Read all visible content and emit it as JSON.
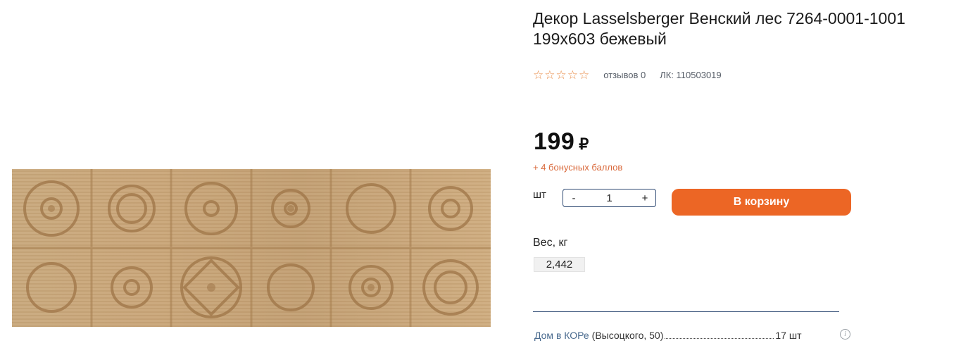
{
  "product": {
    "title": "Декор Lasselsberger Венский лес 7264-0001-1001 199х603 бежевый",
    "rating": {
      "stars": 0,
      "max": 5,
      "star_icon": "star-outline-icon"
    },
    "reviews_label": "отзывов 0",
    "sku_label": "ЛК: 110503019",
    "price": "199",
    "currency": "₽",
    "bonus": "+ 4 бонусных баллов"
  },
  "purchase": {
    "unit": "шт",
    "qty_minus": "-",
    "qty_value": "1",
    "qty_plus": "+",
    "cart_button": "В корзину"
  },
  "specs": {
    "weight_label": "Вес, кг",
    "weight_value": "2,442"
  },
  "availability": {
    "store_name": "Дом в КОРе",
    "store_address": "(Высоцкого, 50)",
    "stock": "17 шт",
    "info_icon": "info-icon"
  },
  "colors": {
    "accent": "#ec6625",
    "star": "#e98e4b",
    "bonus": "#d9683a",
    "link": "#4a6b8f",
    "border": "#2f4a73"
  }
}
